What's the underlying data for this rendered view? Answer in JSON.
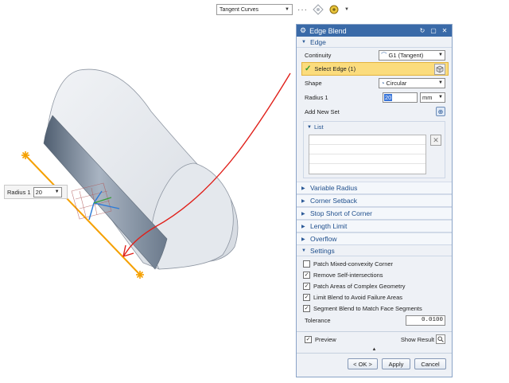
{
  "toolbar": {
    "curve_rule": "Tangent Curves",
    "more": "···"
  },
  "viewport": {
    "radius_label": "Radius 1",
    "radius_value": "20"
  },
  "dialog": {
    "title": "Edge Blend",
    "edge_section": "Edge",
    "continuity_label": "Continuity",
    "continuity_value": "G1 (Tangent)",
    "select_edge_label": "Select Edge (1)",
    "shape_label": "Shape",
    "shape_value": "Circular",
    "radius_label": "Radius 1",
    "radius_value": "20",
    "radius_unit": "mm",
    "add_new_set_label": "Add New Set",
    "list_label": "List",
    "collapsed_sections": [
      "Variable Radius",
      "Corner Setback",
      "Stop Short of Corner",
      "Length Limit",
      "Overflow"
    ],
    "settings_section": "Settings",
    "settings": [
      {
        "label": "Patch Mixed-convexity Corner",
        "checked": false
      },
      {
        "label": "Remove Self-intersections",
        "checked": true
      },
      {
        "label": "Patch Areas of Complex Geometry",
        "checked": true
      },
      {
        "label": "Limit Blend to Avoid Failure Areas",
        "checked": true
      },
      {
        "label": "Segment Blend to Match Face Segments",
        "checked": true
      }
    ],
    "tolerance_label": "Tolerance",
    "tolerance_value": "0.0100",
    "preview_label": "Preview",
    "show_result_label": "Show Result",
    "ok_label": "< OK >",
    "apply_label": "Apply",
    "cancel_label": "Cancel"
  },
  "colors": {
    "title_bar": "#3a6aa8",
    "selection_highlight": "#fbdc7d",
    "edge_highlight": "#f5a000",
    "annotation": "#e0201a"
  }
}
